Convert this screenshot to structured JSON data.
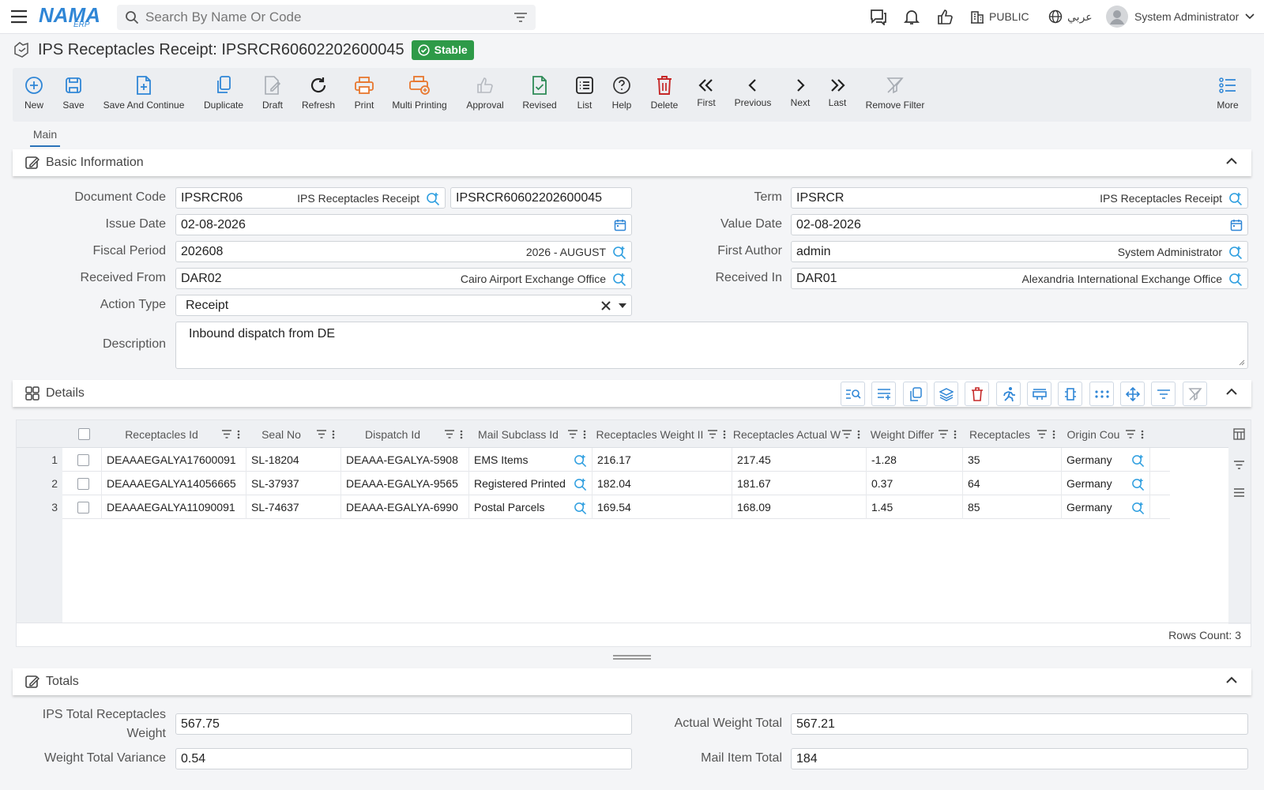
{
  "app": {
    "logo_text": "NAMA",
    "logo_sub": "ERP"
  },
  "topbar": {
    "search_placeholder": "Search By Name Or Code",
    "branch": "PUBLIC",
    "language": "عربي",
    "user_name": "System Administrator"
  },
  "page": {
    "title": "IPS Receptacles Receipt: IPSRCR60602202600045",
    "status": "Stable"
  },
  "toolbar": {
    "new": "New",
    "save": "Save",
    "save_continue": "Save And Continue",
    "duplicate": "Duplicate",
    "draft": "Draft",
    "refresh": "Refresh",
    "print": "Print",
    "multi_printing": "Multi Printing",
    "approval": "Approval",
    "revised": "Revised",
    "list": "List",
    "help": "Help",
    "delete": "Delete",
    "first": "First",
    "previous": "Previous",
    "next": "Next",
    "last": "Last",
    "remove_filter": "Remove Filter",
    "more": "More"
  },
  "tabs": {
    "main": "Main"
  },
  "basic": {
    "title": "Basic Information",
    "document_code": {
      "label": "Document Code",
      "code": "IPSRCR06",
      "name": "IPS Receptacles Receipt",
      "number": "IPSRCR60602202600045"
    },
    "term": {
      "label": "Term",
      "code": "IPSRCR",
      "name": "IPS Receptacles Receipt"
    },
    "issue_date": {
      "label": "Issue Date",
      "value": "02-08-2026"
    },
    "value_date": {
      "label": "Value Date",
      "value": "02-08-2026"
    },
    "fiscal_period": {
      "label": "Fiscal Period",
      "code": "202608",
      "name": "2026 - AUGUST"
    },
    "first_author": {
      "label": "First Author",
      "code": "admin",
      "name": "System Administrator"
    },
    "received_from": {
      "label": "Received From",
      "code": "DAR02",
      "name": "Cairo Airport Exchange Office"
    },
    "received_in": {
      "label": "Received In",
      "code": "DAR01",
      "name": "Alexandria International Exchange Office"
    },
    "action_type": {
      "label": "Action Type",
      "value": "Receipt"
    },
    "description": {
      "label": "Description",
      "value": "Inbound dispatch from DE"
    }
  },
  "details": {
    "title": "Details",
    "columns": [
      "Receptacles Id",
      "Seal No",
      "Dispatch Id",
      "Mail Subclass Id",
      "Receptacles Weight II",
      "Receptacles Actual W",
      "Weight Differ",
      "Receptacles",
      "Origin Cou"
    ],
    "rows": [
      {
        "num": "1",
        "receptacle_id": "DEAAAEGALYA17600091",
        "seal_no": "SL-18204",
        "dispatch_id": "DEAAA-EGALYA-5908",
        "subclass": "EMS Items",
        "weight": "216.17",
        "actual_weight": "217.45",
        "difference": "-1.28",
        "receptacles": "35",
        "origin": "Germany"
      },
      {
        "num": "2",
        "receptacle_id": "DEAAAEGALYA14056665",
        "seal_no": "SL-37937",
        "dispatch_id": "DEAAA-EGALYA-9565",
        "subclass": "Registered Printed",
        "weight": "182.04",
        "actual_weight": "181.67",
        "difference": "0.37",
        "receptacles": "64",
        "origin": "Germany"
      },
      {
        "num": "3",
        "receptacle_id": "DEAAAEGALYA11090091",
        "seal_no": "SL-74637",
        "dispatch_id": "DEAAA-EGALYA-6990",
        "subclass": "Postal Parcels",
        "weight": "169.54",
        "actual_weight": "168.09",
        "difference": "1.45",
        "receptacles": "85",
        "origin": "Germany"
      }
    ],
    "rows_count": "Rows Count: 3"
  },
  "totals": {
    "title": "Totals",
    "ips_total_label_1": "IPS Total Receptacles",
    "ips_total_label_2": "Weight",
    "ips_total_value": "567.75",
    "actual_total_label": "Actual Weight Total",
    "actual_total_value": "567.21",
    "variance_label": "Weight Total Variance",
    "variance_value": "0.54",
    "mail_item_label": "Mail Item Total",
    "mail_item_value": "184"
  },
  "colors": {
    "accent": "#2a73b9",
    "stable": "#2e9a48",
    "icon_blue": "#2f86d6",
    "delete_red": "#c62828",
    "print_orange": "#e8772e",
    "revised_green": "#2e8b57"
  }
}
